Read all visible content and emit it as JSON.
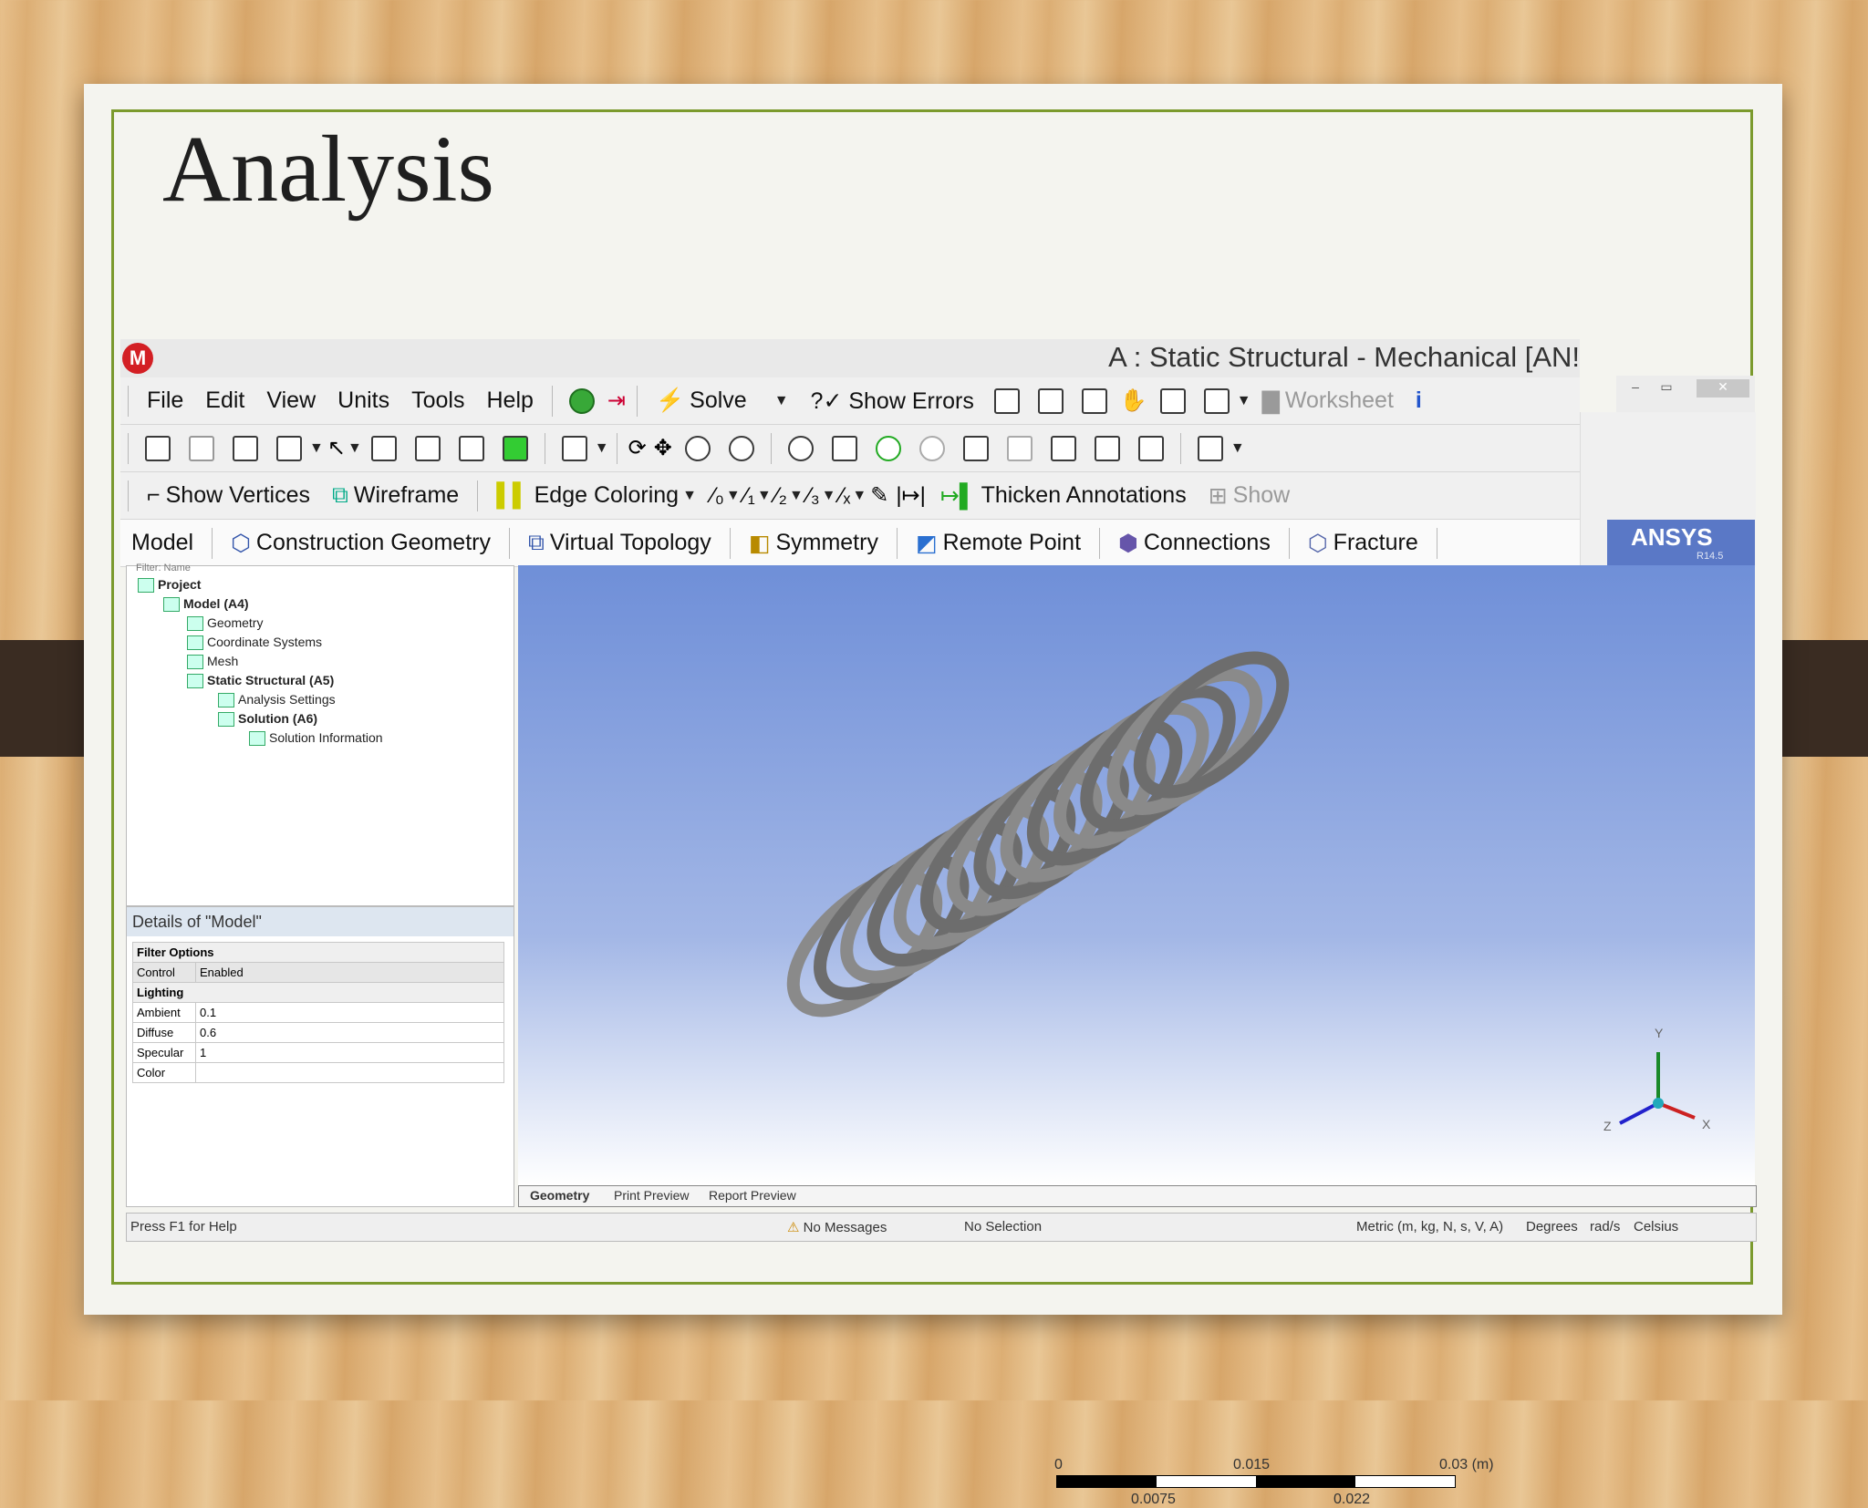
{
  "slide": {
    "title": "Analysis"
  },
  "app": {
    "logo": "M",
    "title": "A : Static Structural - Mechanical [AN!",
    "window_buttons": [
      "–",
      "▭",
      "✕"
    ]
  },
  "menu": [
    "File",
    "Edit",
    "View",
    "Units",
    "Tools",
    "Help"
  ],
  "toolbar1": {
    "solve": "Solve",
    "show_errors": "?✓ Show Errors",
    "worksheet": "Worksheet",
    "info": "i"
  },
  "toolbar3": {
    "show_vertices": "Show Vertices",
    "wireframe": "Wireframe",
    "edge_coloring": "Edge Coloring",
    "thicken_annotations": "Thicken Annotations",
    "show": "Show"
  },
  "context_toolbar": {
    "model": "Model",
    "construction_geometry": "Construction Geometry",
    "virtual_topology": "Virtual Topology",
    "symmetry": "Symmetry",
    "remote_point": "Remote Point",
    "connections": "Connections",
    "fracture": "Fracture"
  },
  "tree": {
    "filter_label": "Filter: Name",
    "items": [
      {
        "label": "Project",
        "level": 0,
        "bold": true
      },
      {
        "label": "Model (A4)",
        "level": 1,
        "bold": true
      },
      {
        "label": "Geometry",
        "level": 2,
        "bold": false
      },
      {
        "label": "Coordinate Systems",
        "level": 2,
        "bold": false
      },
      {
        "label": "Mesh",
        "level": 2,
        "bold": false
      },
      {
        "label": "Static Structural (A5)",
        "level": 2,
        "bold": true
      },
      {
        "label": "Analysis Settings",
        "level": 3,
        "bold": false
      },
      {
        "label": "Solution (A6)",
        "level": 3,
        "bold": true
      },
      {
        "label": "Solution Information",
        "level": 4,
        "bold": false
      }
    ]
  },
  "details": {
    "title": "Details of \"Model\"",
    "rows": [
      {
        "group": "Filter Options"
      },
      {
        "label": "Control",
        "value": "Enabled"
      },
      {
        "group": "Lighting"
      },
      {
        "label": "Ambient",
        "value": "0.1"
      },
      {
        "label": "Diffuse",
        "value": "0.6"
      },
      {
        "label": "Specular",
        "value": "1"
      },
      {
        "label": "Color",
        "value": ""
      }
    ]
  },
  "brand": {
    "name": "ANSYS",
    "version": "R14.5"
  },
  "scale_bar": {
    "top_labels": [
      "0",
      "0.015",
      "0.03 (m)"
    ],
    "bottom_labels": [
      "0.0075",
      "0.022"
    ]
  },
  "triad": {
    "y": "Y",
    "z": "Z",
    "x": "X"
  },
  "view_tabs": [
    "Geometry",
    "Print Preview",
    "Report Preview"
  ],
  "status": {
    "help": "Press F1 for Help",
    "messages": "No Messages",
    "selection": "No Selection",
    "units": "Metric (m, kg, N, s, V, A)",
    "angle": "Degrees",
    "rate": "rad/s",
    "temp": "Celsius"
  },
  "colors": {
    "slide_border": "#7b9a2d",
    "viewport_top": "#6f8fd8",
    "ansys_brand": "#5a78c6",
    "logo_red": "#d31f24"
  },
  "icons": [
    "check-icon",
    "solve-lightning-icon",
    "show-errors-icon",
    "worksheet-icon",
    "info-icon",
    "rotate-icon",
    "pan-icon",
    "zoom-icon",
    "box-zoom-icon",
    "fit-icon",
    "iso-icon",
    "wireframe-icon",
    "edge-coloring-icon",
    "construction-geometry-icon",
    "virtual-topology-icon",
    "symmetry-icon",
    "remote-point-icon",
    "connections-icon",
    "fracture-icon",
    "spring-model"
  ]
}
